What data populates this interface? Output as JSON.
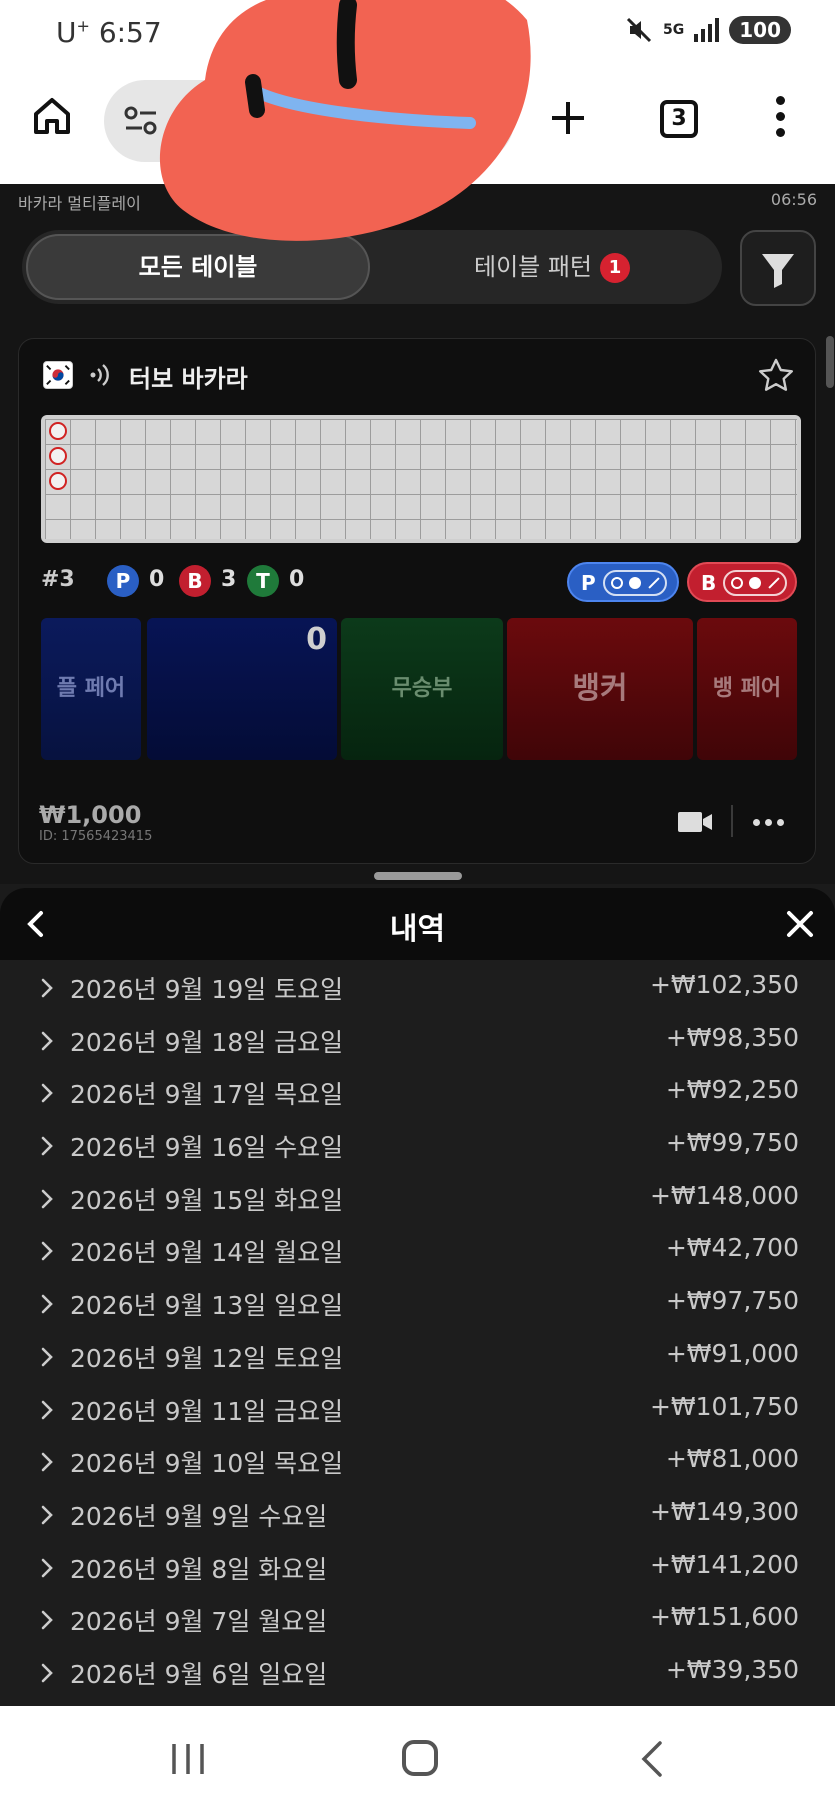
{
  "status_bar": {
    "carrier": "U",
    "carrier_sup": "+",
    "time": "6:57",
    "network": "5G",
    "battery": "100"
  },
  "browser": {
    "tab_count": "3"
  },
  "page": {
    "breadcrumb": "바카라 멀티플레이",
    "time": "06:56",
    "tabs": [
      {
        "label": "모든 테이블"
      },
      {
        "label": "테이블 패턴",
        "badge": "1"
      }
    ]
  },
  "table_card": {
    "title": "터보 바카라",
    "round": "#3",
    "player_label": "P",
    "player_count": "0",
    "banker_label": "B",
    "banker_count": "3",
    "tie_label": "T",
    "tie_count": "0",
    "player_predict_label": "P",
    "banker_predict_label": "B",
    "bets": {
      "player_pair": "플 페어",
      "player_total": "0",
      "tie": "무승부",
      "banker": "뱅커",
      "banker_pair": "뱅 페어"
    },
    "min_bet": "₩1,000",
    "table_id": "ID: 17565423415"
  },
  "history": {
    "title": "내역",
    "rows": [
      {
        "date": "2026년 9월 19일 토요일",
        "amount": "+₩102,350"
      },
      {
        "date": "2026년 9월 18일 금요일",
        "amount": "+₩98,350"
      },
      {
        "date": "2026년 9월 17일 목요일",
        "amount": "+₩92,250"
      },
      {
        "date": "2026년 9월 16일 수요일",
        "amount": "+₩99,750"
      },
      {
        "date": "2026년 9월 15일 화요일",
        "amount": "+₩148,000"
      },
      {
        "date": "2026년 9월 14일 월요일",
        "amount": "+₩42,700"
      },
      {
        "date": "2026년 9월 13일 일요일",
        "amount": "+₩97,750"
      },
      {
        "date": "2026년 9월 12일 토요일",
        "amount": "+₩91,000"
      },
      {
        "date": "2026년 9월 11일 금요일",
        "amount": "+₩101,750"
      },
      {
        "date": "2026년 9월 10일 목요일",
        "amount": "+₩81,000"
      },
      {
        "date": "2026년 9월 9일 수요일",
        "amount": "+₩149,300"
      },
      {
        "date": "2026년 9월 8일 화요일",
        "amount": "+₩141,200"
      },
      {
        "date": "2026년 9월 7일 월요일",
        "amount": "+₩151,600"
      },
      {
        "date": "2026년 9월 6일 일요일",
        "amount": "+₩39,350"
      }
    ]
  },
  "colors": {
    "player": "#2a5fc4",
    "banker": "#c21f2f",
    "tie": "#1f7a3a",
    "sticker": "#f26352"
  }
}
